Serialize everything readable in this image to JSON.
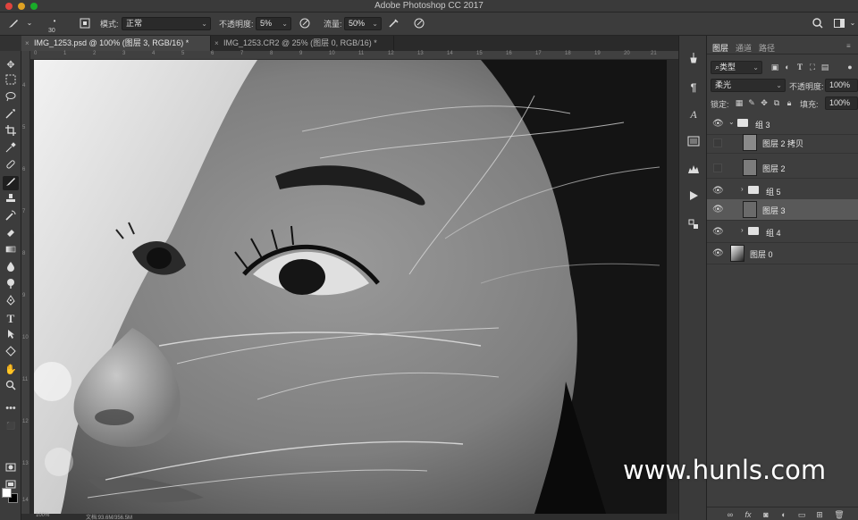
{
  "app": {
    "title": "Adobe Photoshop CC 2017"
  },
  "options_bar": {
    "brush_size": "30",
    "mode_label": "模式:",
    "mode_value": "正常",
    "opacity_label": "不透明度:",
    "opacity_value": "5%",
    "flow_label": "流量:",
    "flow_value": "50%"
  },
  "tabs": [
    {
      "close": "×",
      "label": "IMG_1253.psd @ 100% (图层 3, RGB/16) *"
    },
    {
      "close": "×",
      "label": "IMG_1253.CR2 @ 25% (图层 0, RGB/16) *"
    }
  ],
  "rulers": {
    "top": [
      "0",
      "1",
      "2",
      "3",
      "4",
      "5",
      "6",
      "7",
      "8",
      "9",
      "10",
      "11",
      "12",
      "13",
      "14",
      "15",
      "16",
      "17",
      "18",
      "19",
      "20",
      "21"
    ],
    "left": [
      "4",
      "5",
      "6",
      "7",
      "8",
      "9",
      "10",
      "11",
      "12",
      "13",
      "14"
    ]
  },
  "status": {
    "zoom": "100%",
    "doc": "文档:93.6M/356.5M"
  },
  "layers_panel": {
    "tabs": [
      "图层",
      "通道",
      "路径"
    ],
    "filter_value": "类型",
    "blend_value": "柔光",
    "opacity_label": "不透明度:",
    "opacity_value": "100%",
    "lock_label": "锁定:",
    "fill_label": "填充:",
    "fill_value": "100%",
    "layers": [
      {
        "name": "组 3"
      },
      {
        "name": "图层 2 拷贝"
      },
      {
        "name": "图层 2"
      },
      {
        "name": "组 5"
      },
      {
        "name": "图层 3"
      },
      {
        "name": "组 4"
      },
      {
        "name": "图层 0"
      }
    ]
  },
  "watermark": "www.hunls.com"
}
